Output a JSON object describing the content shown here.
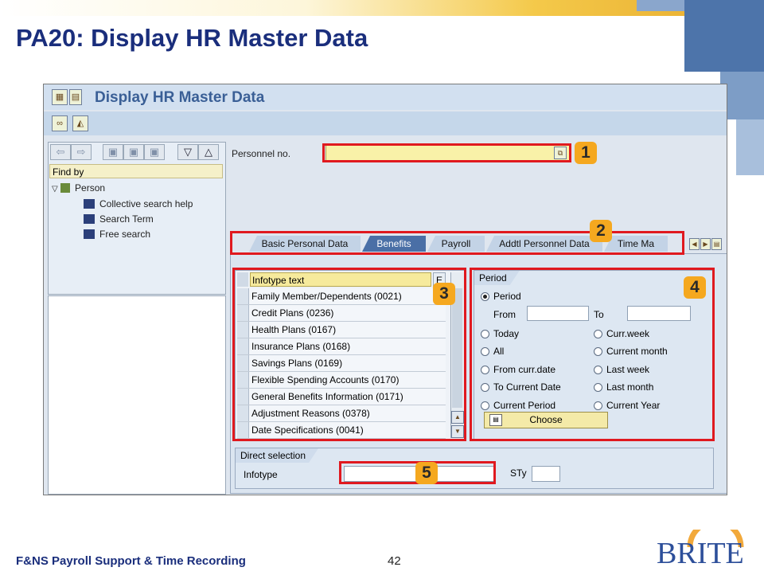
{
  "slide": {
    "title": "PA20: Display HR Master Data",
    "footer": "F&NS Payroll Support & Time Recording",
    "page_number": "42",
    "logo_text": "BRITE"
  },
  "sap": {
    "title": "Display HR Master Data",
    "left_nav": {
      "find_by_label": "Find by",
      "tree": {
        "root": "Person",
        "children": [
          "Collective search help",
          "Search Term",
          "Free search"
        ]
      }
    },
    "personnel": {
      "label": "Personnel no.",
      "value": ""
    },
    "tabs": [
      "Basic Personal Data",
      "Benefits",
      "Payroll",
      "Addtl Personnel Data",
      "Time Ma"
    ],
    "active_tab": "Benefits",
    "infotype_table": {
      "header": "Infotype text",
      "header2": "E",
      "rows": [
        "Family Member/Dependents (0021)",
        "Credit Plans (0236)",
        "Health Plans (0167)",
        "Insurance Plans (0168)",
        "Savings Plans (0169)",
        "Flexible Spending Accounts (0170)",
        "General Benefits Information (0171)",
        "Adjustment Reasons (0378)",
        "Date Specifications (0041)"
      ]
    },
    "period": {
      "header": "Period",
      "period_option": "Period",
      "from_label": "From",
      "to_label": "To",
      "options_left": [
        "Today",
        "All",
        "From curr.date",
        "To Current Date",
        "Current Period"
      ],
      "options_right": [
        "Curr.week",
        "Current month",
        "Last week",
        "Last month",
        "Current Year"
      ],
      "choose_label": "Choose",
      "selected": "Period"
    },
    "direct_selection": {
      "header": "Direct selection",
      "infotype_label": "Infotype",
      "sty_label": "STy"
    }
  },
  "markers": [
    "1",
    "2",
    "3",
    "4",
    "5"
  ],
  "colors": {
    "title_blue": "#1a2e7c",
    "highlight_red": "#e0191f",
    "marker_orange": "#f5a81f",
    "active_tab": "#4a6fa6"
  }
}
